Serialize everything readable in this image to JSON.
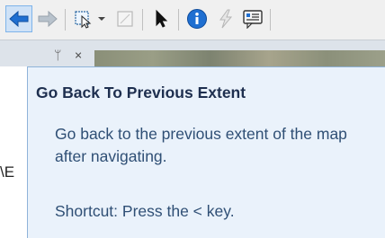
{
  "toolbar": {
    "buttons": [
      {
        "icon": "back-arrow-icon",
        "active": true
      },
      {
        "icon": "forward-arrow-icon",
        "active": false
      },
      {
        "icon": "select-features-icon",
        "dropdown": true
      },
      {
        "icon": "clear-selection-icon"
      },
      {
        "icon": "select-elements-icon"
      },
      {
        "icon": "identify-icon"
      },
      {
        "icon": "hyperlink-lightning-icon"
      },
      {
        "icon": "html-popup-icon"
      }
    ]
  },
  "panel": {
    "pin_glyph": "ᛘ",
    "close_glyph": "×"
  },
  "left_path_fragment": "\\E",
  "tooltip": {
    "title": "Go Back To Previous Extent",
    "description": "Go back to the previous extent of the map after navigating.",
    "shortcut": "Shortcut: Press the < key."
  },
  "colors": {
    "tooltip_bg": "#eaf2fb",
    "tooltip_title": "#1e2f4f",
    "tooltip_text": "#2f4f75",
    "accent_blue": "#1f6fd1"
  }
}
